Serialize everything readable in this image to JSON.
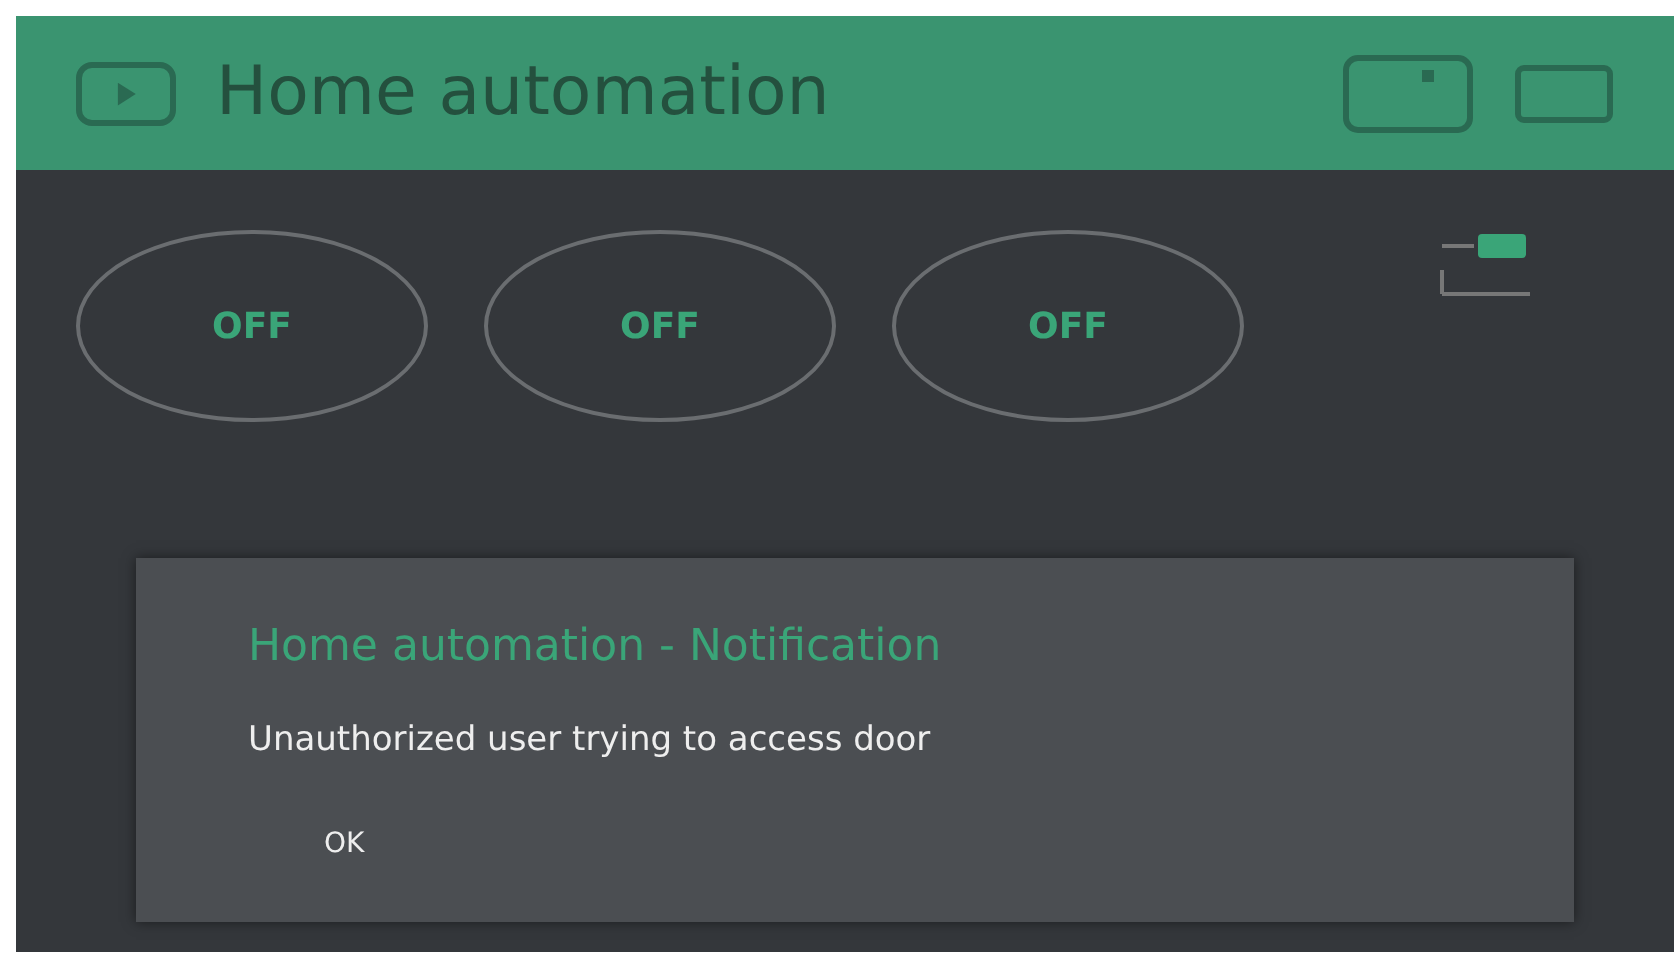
{
  "header": {
    "title": "Home automation"
  },
  "buttons": [
    {
      "label": "OFF",
      "on": false
    },
    {
      "label": "OFF",
      "on": false
    },
    {
      "label": "OFF",
      "on": false
    }
  ],
  "dialog": {
    "title": "Home automation - Notification",
    "message": "Unauthorized user trying to access door",
    "button": "OK"
  }
}
